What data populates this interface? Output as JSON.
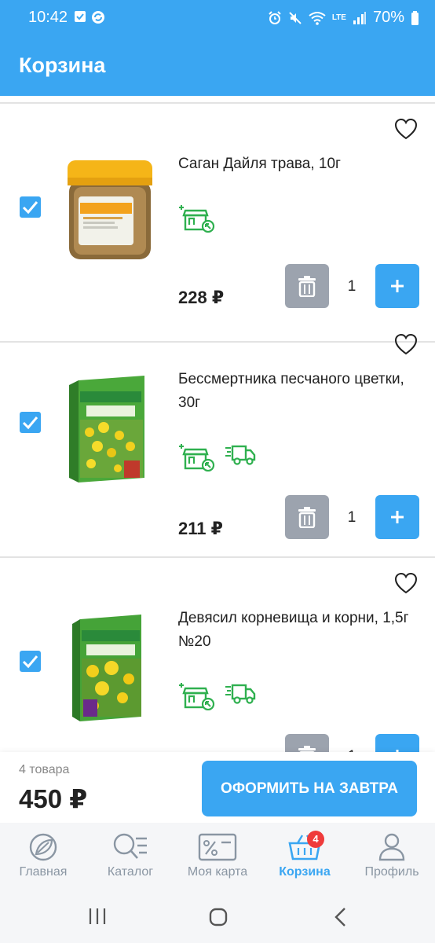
{
  "status": {
    "time": "10:42",
    "battery": "70%",
    "network": "LTE"
  },
  "header": {
    "title": "Корзина"
  },
  "colors": {
    "accent": "#3aa6f2",
    "badge_green": "#2fb04f",
    "delete_gray": "#9ca3ae",
    "cart_badge": "#ef3b3b"
  },
  "cart": {
    "items": [
      {
        "name": "Саган Дайля трава, 10г",
        "price": "228 ₽",
        "quantity": "1",
        "checked": true,
        "badges": [
          "pickup-store-icon"
        ]
      },
      {
        "name": "Бессмертника песчаного цветки, 30г",
        "price": "211 ₽",
        "quantity": "1",
        "checked": true,
        "badges": [
          "pickup-store-icon",
          "delivery-truck-icon"
        ]
      },
      {
        "name": "Девясил корневища и корни, 1,5г №20",
        "price": "",
        "quantity": "1",
        "checked": true,
        "badges": [
          "pickup-store-icon",
          "delivery-truck-icon"
        ]
      }
    ]
  },
  "footer": {
    "count": "4 товара",
    "total": "450 ₽",
    "checkout_label": "ОФОРМИТЬ НА ЗАВТРА"
  },
  "tabbar": {
    "items": [
      {
        "label": "Главная",
        "icon": "home-leaf-icon"
      },
      {
        "label": "Каталог",
        "icon": "catalog-search-icon"
      },
      {
        "label": "Моя карта",
        "icon": "discount-card-icon"
      },
      {
        "label": "Корзина",
        "icon": "basket-icon",
        "badge": "4",
        "active": true
      },
      {
        "label": "Профиль",
        "icon": "profile-icon"
      }
    ]
  }
}
